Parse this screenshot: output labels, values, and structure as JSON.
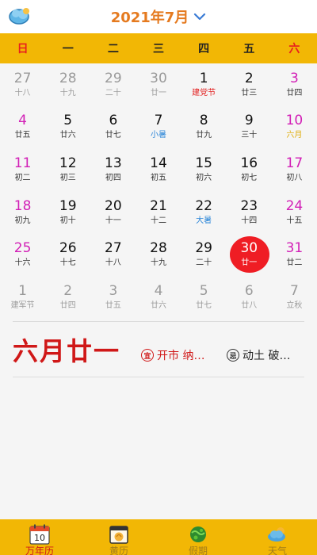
{
  "header": {
    "month_title": "2021年7月"
  },
  "weekdays": [
    {
      "label": "日",
      "red": true
    },
    {
      "label": "一",
      "red": false
    },
    {
      "label": "二",
      "red": false
    },
    {
      "label": "三",
      "red": false
    },
    {
      "label": "四",
      "red": false
    },
    {
      "label": "五",
      "red": false
    },
    {
      "label": "六",
      "red": true
    }
  ],
  "days": [
    {
      "day": "27",
      "sub": "十八",
      "muted": true
    },
    {
      "day": "28",
      "sub": "十九",
      "muted": true
    },
    {
      "day": "29",
      "sub": "二十",
      "muted": true
    },
    {
      "day": "30",
      "sub": "廿一",
      "muted": true
    },
    {
      "day": "1",
      "sub": "建党节",
      "kind": "fest"
    },
    {
      "day": "2",
      "sub": "廿三"
    },
    {
      "day": "3",
      "sub": "廿四",
      "weekend": true
    },
    {
      "day": "4",
      "sub": "廿五",
      "weekend": true
    },
    {
      "day": "5",
      "sub": "廿六"
    },
    {
      "day": "6",
      "sub": "廿七"
    },
    {
      "day": "7",
      "sub": "小暑",
      "kind": "term"
    },
    {
      "day": "8",
      "sub": "廿九"
    },
    {
      "day": "9",
      "sub": "三十"
    },
    {
      "day": "10",
      "sub": "六月",
      "weekend": true,
      "kind": "month"
    },
    {
      "day": "11",
      "sub": "初二",
      "weekend": true
    },
    {
      "day": "12",
      "sub": "初三"
    },
    {
      "day": "13",
      "sub": "初四"
    },
    {
      "day": "14",
      "sub": "初五"
    },
    {
      "day": "15",
      "sub": "初六"
    },
    {
      "day": "16",
      "sub": "初七"
    },
    {
      "day": "17",
      "sub": "初八",
      "weekend": true
    },
    {
      "day": "18",
      "sub": "初九",
      "weekend": true
    },
    {
      "day": "19",
      "sub": "初十"
    },
    {
      "day": "20",
      "sub": "十一"
    },
    {
      "day": "21",
      "sub": "十二"
    },
    {
      "day": "22",
      "sub": "大暑",
      "kind": "term"
    },
    {
      "day": "23",
      "sub": "十四"
    },
    {
      "day": "24",
      "sub": "十五",
      "weekend": true
    },
    {
      "day": "25",
      "sub": "十六",
      "weekend": true
    },
    {
      "day": "26",
      "sub": "十七"
    },
    {
      "day": "27",
      "sub": "十八"
    },
    {
      "day": "28",
      "sub": "十九"
    },
    {
      "day": "29",
      "sub": "二十"
    },
    {
      "day": "30",
      "sub": "廿一",
      "today": true
    },
    {
      "day": "31",
      "sub": "廿二",
      "weekend": true
    },
    {
      "day": "1",
      "sub": "建军节",
      "muted": true,
      "kind": "fest"
    },
    {
      "day": "2",
      "sub": "廿四",
      "muted": true
    },
    {
      "day": "3",
      "sub": "廿五",
      "muted": true
    },
    {
      "day": "4",
      "sub": "廿六",
      "muted": true
    },
    {
      "day": "5",
      "sub": "廿七",
      "muted": true
    },
    {
      "day": "6",
      "sub": "廿八",
      "muted": true
    },
    {
      "day": "7",
      "sub": "立秋",
      "muted": true
    }
  ],
  "selected": {
    "lunar_date": "六月廿一",
    "yi_badge": "宜",
    "yi_text": "开市 纳…",
    "ji_badge": "忌",
    "ji_text": "动土 破…"
  },
  "tabs": [
    {
      "label": "万年历",
      "icon": "calendar-10-icon",
      "calendar_number": "10",
      "active": true
    },
    {
      "label": "黄历",
      "icon": "almanac-icon",
      "active": false
    },
    {
      "label": "假期",
      "icon": "holiday-globe-icon",
      "active": false
    },
    {
      "label": "天气",
      "icon": "weather-cloud-icon",
      "active": false
    }
  ],
  "colors": {
    "accent_orange": "#e57a1f",
    "bar_yellow": "#f2b705",
    "today_red": "#ef1d24",
    "weekend_magenta": "#d21fb6",
    "solar_term_blue": "#2c86d8",
    "festival_red": "#e21d1d"
  }
}
